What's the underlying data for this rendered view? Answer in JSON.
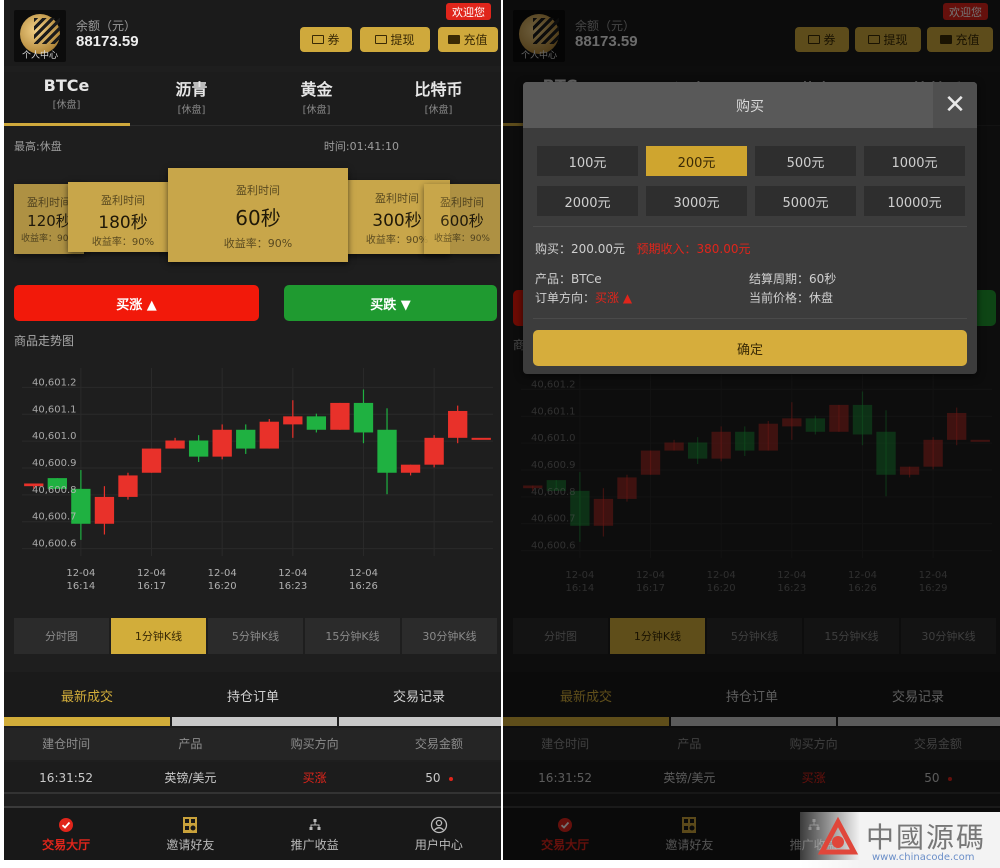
{
  "colors": {
    "gold": "#cfa93c",
    "up_red": "#e8312a",
    "down_green": "#1fb141",
    "background": "#1e1e1e"
  },
  "header": {
    "avatar_label": "个人中心",
    "balance_label": "余额（元）",
    "balance_value": "88173.59",
    "coupon_button": "券",
    "withdraw_button": "提现",
    "recharge_button": "充值",
    "welcome_badge": "欢迎您"
  },
  "product_tabs": [
    {
      "name": "BTCe",
      "status": "[休盘]"
    },
    {
      "name": "沥青",
      "status": "[休盘]"
    },
    {
      "name": "黄金",
      "status": "[休盘]"
    },
    {
      "name": "比特币",
      "status": "[休盘]"
    }
  ],
  "status_row": {
    "left": "最高:休盘",
    "time": "时间:01:41:10"
  },
  "period_cards": [
    {
      "label": "盈利时间",
      "period": "120秒",
      "rate": "收益率：90%"
    },
    {
      "label": "盈利时间",
      "period": "180秒",
      "rate": "收益率：90%"
    },
    {
      "label": "盈利时间",
      "period": "60秒",
      "rate": "收益率：90%"
    },
    {
      "label": "盈利时间",
      "period": "300秒",
      "rate": "收益率：90%"
    },
    {
      "label": "盈利时间",
      "period": "600秒",
      "rate": "收益率：90%"
    }
  ],
  "buy_up": "买涨 ▲",
  "buy_down": "买跌 ▼",
  "chart_title": "商品走势图",
  "chart_data": {
    "type": "candlestick",
    "title": "商品走势图",
    "xlabel": "",
    "ylabel": "",
    "ylim": [
      40600.55,
      40601.25
    ],
    "y_ticks": [
      "40,601.2",
      "40,601.1",
      "40,601.0",
      "40,600.9",
      "40,600.8",
      "40,600.7",
      "40,600.6"
    ],
    "y_tick_values": [
      40601.2,
      40601.1,
      40601.0,
      40600.9,
      40600.8,
      40600.7,
      40600.6
    ],
    "x_ticks": [
      [
        "12-04",
        "16:14"
      ],
      [
        "12-04",
        "16:17"
      ],
      [
        "12-04",
        "16:20"
      ],
      [
        "12-04",
        "16:23"
      ],
      [
        "12-04",
        "16:26"
      ],
      [
        "12-04",
        "16:29"
      ]
    ],
    "x_tick_index": [
      2,
      5,
      8,
      11,
      14,
      17
    ],
    "grid": true,
    "up_color": "#e8312a",
    "down_color": "#1fb141",
    "candles": [
      {
        "o": 40600.81,
        "c": 40600.82,
        "h": 40600.82,
        "l": 40600.8
      },
      {
        "o": 40600.84,
        "c": 40600.8,
        "h": 40600.84,
        "l": 40600.8
      },
      {
        "o": 40600.8,
        "c": 40600.67,
        "h": 40600.87,
        "l": 40600.61
      },
      {
        "o": 40600.67,
        "c": 40600.77,
        "h": 40600.81,
        "l": 40600.63
      },
      {
        "o": 40600.77,
        "c": 40600.85,
        "h": 40600.86,
        "l": 40600.76
      },
      {
        "o": 40600.86,
        "c": 40600.95,
        "h": 40600.95,
        "l": 40600.86
      },
      {
        "o": 40600.95,
        "c": 40600.98,
        "h": 40600.99,
        "l": 40600.95
      },
      {
        "o": 40600.98,
        "c": 40600.92,
        "h": 40601.0,
        "l": 40600.9
      },
      {
        "o": 40600.92,
        "c": 40601.02,
        "h": 40601.04,
        "l": 40600.91
      },
      {
        "o": 40601.02,
        "c": 40600.95,
        "h": 40601.04,
        "l": 40600.93
      },
      {
        "o": 40600.95,
        "c": 40601.05,
        "h": 40601.06,
        "l": 40600.95
      },
      {
        "o": 40601.04,
        "c": 40601.07,
        "h": 40601.13,
        "l": 40600.99
      },
      {
        "o": 40601.07,
        "c": 40601.02,
        "h": 40601.08,
        "l": 40601.01
      },
      {
        "o": 40601.02,
        "c": 40601.12,
        "h": 40601.12,
        "l": 40601.02
      },
      {
        "o": 40601.12,
        "c": 40601.01,
        "h": 40601.17,
        "l": 40600.97
      },
      {
        "o": 40601.02,
        "c": 40600.86,
        "h": 40601.1,
        "l": 40600.78
      },
      {
        "o": 40600.86,
        "c": 40600.89,
        "h": 40600.89,
        "l": 40600.85
      },
      {
        "o": 40600.89,
        "c": 40600.99,
        "h": 40601.0,
        "l": 40600.88
      },
      {
        "o": 40600.99,
        "c": 40601.09,
        "h": 40601.11,
        "l": 40600.97
      },
      {
        "o": 40600.99,
        "c": 40600.99,
        "h": 40600.99,
        "l": 40600.99
      }
    ]
  },
  "kline_tabs": [
    {
      "label": "分时图",
      "active": false
    },
    {
      "label": "1分钟K线",
      "active": true
    },
    {
      "label": "5分钟K线",
      "active": false
    },
    {
      "label": "15分钟K线",
      "active": false
    },
    {
      "label": "30分钟K线",
      "active": false
    }
  ],
  "order_tabs": [
    {
      "label": "最新成交",
      "active": true
    },
    {
      "label": "持仓订单",
      "active": false
    },
    {
      "label": "交易记录",
      "active": false
    }
  ],
  "table": {
    "headers": [
      "建仓时间",
      "产品",
      "购买方向",
      "交易金额"
    ],
    "rows": [
      {
        "time": "16:31:52",
        "product": "英镑/美元",
        "direction": "买涨",
        "amount": "50"
      }
    ]
  },
  "bottom_nav": [
    {
      "label": "交易大厅",
      "icon": "check-circle-icon",
      "active": true
    },
    {
      "label": "邀请好友",
      "icon": "qr-code-icon",
      "active": false
    },
    {
      "label": "推广收益",
      "icon": "network-icon",
      "active": false
    },
    {
      "label": "用户中心",
      "icon": "user-icon",
      "active": false
    }
  ],
  "modal": {
    "title": "购买",
    "close": "✕",
    "amounts": [
      {
        "label": "100元",
        "active": false
      },
      {
        "label": "200元",
        "active": true
      },
      {
        "label": "500元",
        "active": false
      },
      {
        "label": "1000元",
        "active": false
      },
      {
        "label": "2000元",
        "active": false
      },
      {
        "label": "3000元",
        "active": false
      },
      {
        "label": "5000元",
        "active": false
      },
      {
        "label": "10000元",
        "active": false
      }
    ],
    "purchase_label": "购买：",
    "purchase_value": "200.00元",
    "expected_label": "预期收入：",
    "expected_value": "380.00元",
    "product_label": "产品：",
    "product_value": "BTCe",
    "period_label": "结算周期：",
    "period_value": "60秒",
    "direction_label": "订单方向：",
    "direction_value": "买涨 ▲",
    "price_label": "当前价格：",
    "price_value": "休盘",
    "confirm": "确定"
  },
  "watermark": {
    "text": "中國源碼",
    "url": "www.chinacode.com"
  }
}
